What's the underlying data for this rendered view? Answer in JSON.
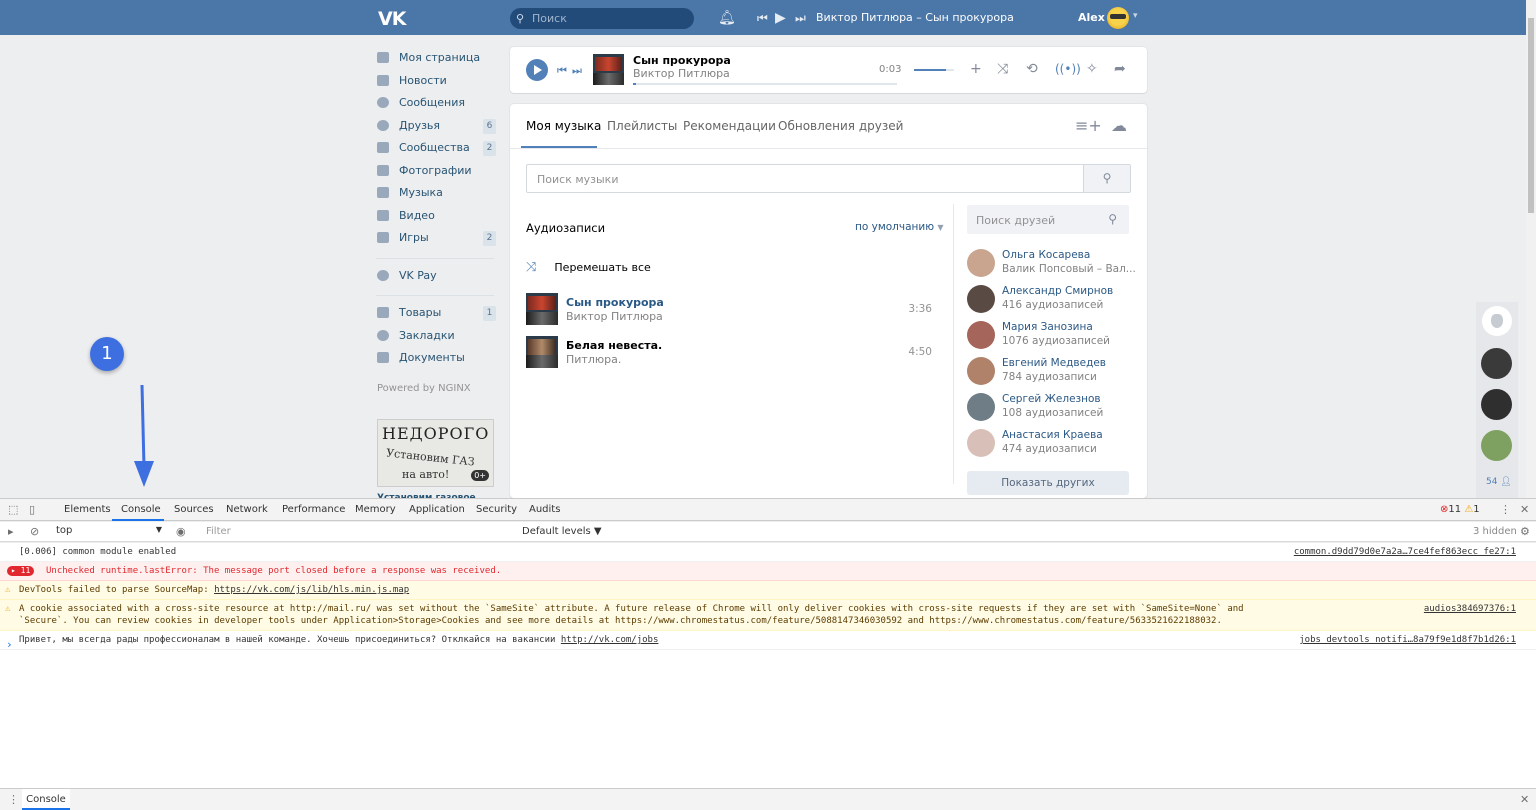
{
  "header": {
    "logo": "VK",
    "search_placeholder": "Поиск",
    "now_playing": "Виктор Питлюра – Сын прокурора",
    "user_name": "Alex"
  },
  "left_menu": {
    "items": [
      {
        "label": "Моя страница",
        "badge": ""
      },
      {
        "label": "Новости",
        "badge": ""
      },
      {
        "label": "Сообщения",
        "badge": ""
      },
      {
        "label": "Друзья",
        "badge": "6"
      },
      {
        "label": "Сообщества",
        "badge": "2"
      },
      {
        "label": "Фотографии",
        "badge": ""
      },
      {
        "label": "Музыка",
        "badge": ""
      },
      {
        "label": "Видео",
        "badge": ""
      },
      {
        "label": "Игры",
        "badge": "2"
      }
    ],
    "vkpay": "VK Pay",
    "items2": [
      {
        "label": "Товары",
        "badge": "1"
      },
      {
        "label": "Закладки",
        "badge": ""
      },
      {
        "label": "Документы",
        "badge": ""
      }
    ],
    "powered": "Powered by NGINX",
    "ad": {
      "line1": "НЕДОРОГО",
      "line2": "Установим ГАЗ",
      "line3": "на авто!",
      "age": "0+",
      "caption": "Установим газовое"
    }
  },
  "player": {
    "title": "Сын прокурора",
    "artist": "Виктор Питлюра",
    "time": "0:03",
    "progress": 0.01,
    "volume": 0.8
  },
  "music": {
    "tabs": [
      "Моя музыка",
      "Плейлисты",
      "Рекомендации",
      "Обновления друзей"
    ],
    "search_placeholder": "Поиск музыки",
    "section_title": "Аудиозаписи",
    "sort_label": "по умолчанию",
    "shuffle_label": "Перемешать все",
    "tracks": [
      {
        "title": "Сын прокурора",
        "artist": "Виктор Питлюра",
        "duration": "3:36"
      },
      {
        "title": "Белая невеста.",
        "artist": "Питлюра.",
        "duration": "4:50"
      }
    ],
    "friends_search_placeholder": "Поиск друзей",
    "friends": [
      {
        "name": "Ольга Косарева",
        "info": "Валик Попсовый – Вал..."
      },
      {
        "name": "Александр Смирнов",
        "info": "416 аудиозаписей"
      },
      {
        "name": "Мария Занозина",
        "info": "1076 аудиозаписей"
      },
      {
        "name": "Евгений Медведев",
        "info": "784 аудиозаписи"
      },
      {
        "name": "Сергей Железнов",
        "info": "108 аудиозаписей"
      },
      {
        "name": "Анастасия Краева",
        "info": "474 аудиозаписи"
      }
    ],
    "show_more": "Показать других"
  },
  "side_chat": {
    "count": "54"
  },
  "devtools": {
    "tabs": [
      "Elements",
      "Console",
      "Sources",
      "Network",
      "Performance",
      "Memory",
      "Application",
      "Security",
      "Audits"
    ],
    "active_tab": "Console",
    "error_count": "11",
    "warning_count": "1",
    "context": "top",
    "filter_placeholder": "Filter",
    "levels": "Default levels ▼",
    "hidden": "3 hidden",
    "messages": [
      {
        "type": "info",
        "text": "[0.006]  common module enabled",
        "source": "common.d9dd79d0e7a2a…7ce4fef863ecc fe27:1"
      },
      {
        "type": "error",
        "count": "11",
        "text": "Unchecked runtime.lastError: The message port closed before a response was received.",
        "source": ""
      },
      {
        "type": "warn",
        "text": "DevTools failed to parse SourceMap: ",
        "link": "https://vk.com/js/lib/hls.min.js.map",
        "source": ""
      },
      {
        "type": "warn",
        "text": "A cookie associated with a cross-site resource at http://mail.ru/ was set without the `SameSite` attribute. A future release of Chrome will only deliver cookies with cross-site requests if they are set with `SameSite=None` and `Secure`. You can review cookies in developer tools under Application>Storage>Cookies and see more details at https://www.chromestatus.com/feature/5088147346030592 and https://www.chromestatus.com/feature/5633521622188032.",
        "source": "audios384697376:1"
      },
      {
        "type": "info",
        "text": "Привет, мы всегда рады профессионалам в нашей команде. Хочешь присоединиться? Отклкайся на вакансии ",
        "link": "http://vk.com/jobs",
        "source": "jobs_devtools_notifi…8a79f9e1d8f7b1d26:1"
      }
    ],
    "drawer_tab": "Console"
  },
  "annotation": {
    "number": "1",
    "color": "#3e6fe0"
  }
}
